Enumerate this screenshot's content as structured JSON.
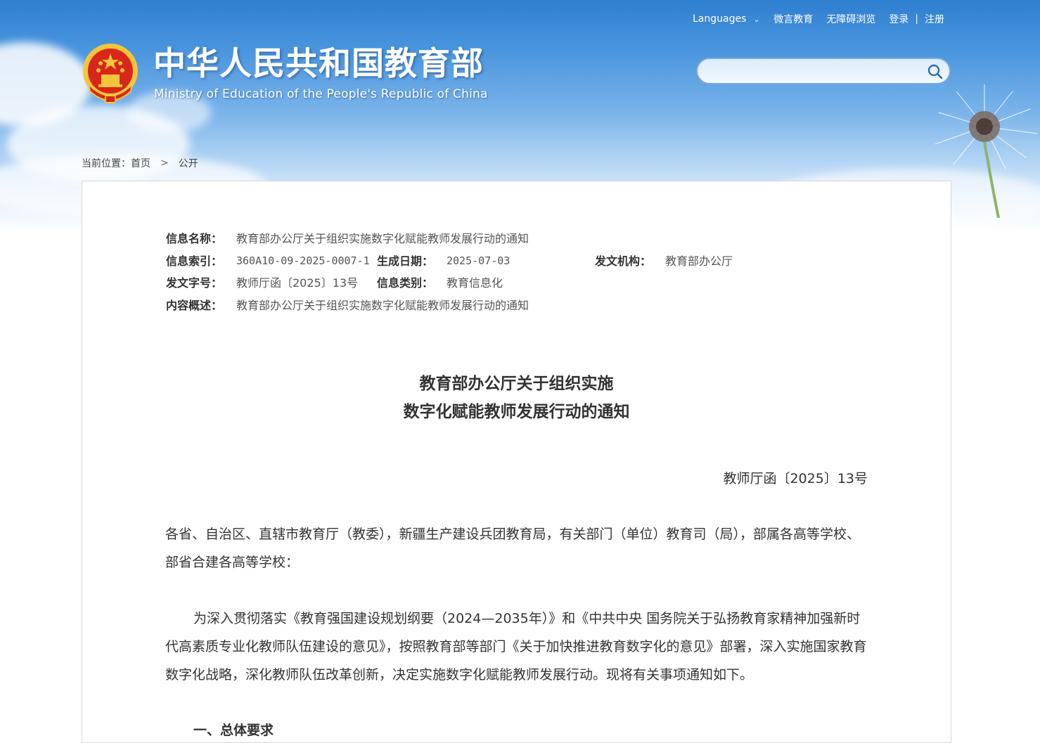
{
  "header": {
    "site_title": "中华人民共和国教育部",
    "site_subtitle": "Ministry of Education of the People's Republic of China",
    "top_links": {
      "languages": "Languages",
      "weiyan": "微言教育",
      "accessibility": "无障碍浏览",
      "login": "登录",
      "separator": "|",
      "register": "注册"
    },
    "search": {
      "placeholder": ""
    }
  },
  "breadcrumb": {
    "prefix": "当前位置：",
    "home": "首页",
    "arrow": ">",
    "current": "公开"
  },
  "meta": {
    "info_name_label": "信息名称：",
    "info_name": "教育部办公厅关于组织实施数字化赋能教师发展行动的通知",
    "index_label": "信息索引：",
    "index": "360A10-09-2025-0007-1",
    "date_label": "生成日期：",
    "date": "2025-07-03",
    "issuer_label": "发文机构：",
    "issuer": "教育部办公厅",
    "doc_no_label": "发文字号：",
    "doc_no": "教师厅函〔2025〕13号",
    "category_label": "信息类别：",
    "category": "教育信息化",
    "summary_label": "内容概述：",
    "summary": "教育部办公厅关于组织实施数字化赋能教师发展行动的通知"
  },
  "document": {
    "title_line1": "教育部办公厅关于组织实施",
    "title_line2": "数字化赋能教师发展行动的通知",
    "number": "教师厅函〔2025〕13号",
    "addressee": "各省、自治区、直辖市教育厅（教委），新疆生产建设兵团教育局，有关部门（单位）教育司（局），部属各高等学校、部省合建各高等学校：",
    "intro": "为深入贯彻落实《教育强国建设规划纲要（2024—2035年）》和《中共中央 国务院关于弘扬教育家精神加强新时代高素质专业化教师队伍建设的意见》，按照教育部等部门《关于加快推进教育数字化的意见》部署，深入实施国家教育数字化战略，深化教师队伍改革创新，决定实施数字化赋能教师发展行动。现将有关事项通知如下。",
    "section1": "一、总体要求"
  },
  "colors": {
    "banner_top": "#2f7fd0",
    "emblem_red": "#d9261c",
    "emblem_gold": "#f3c63a"
  }
}
